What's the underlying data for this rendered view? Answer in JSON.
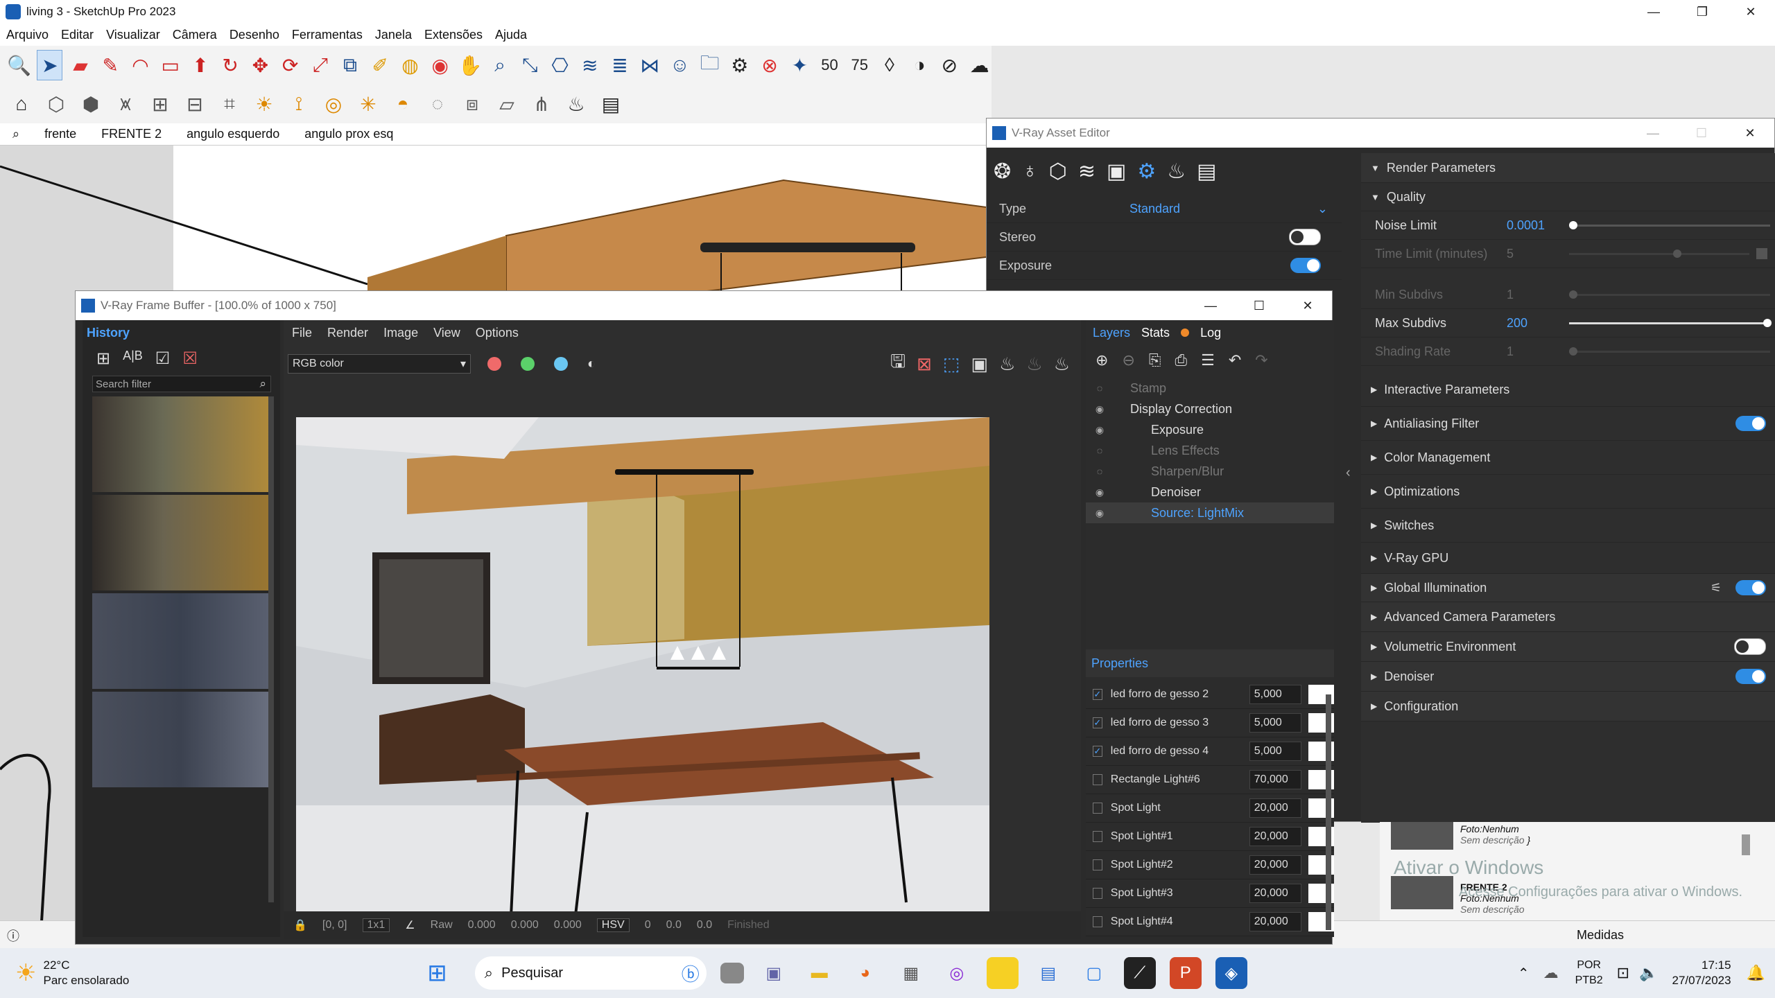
{
  "window": {
    "title": "living 3 - SketchUp Pro 2023"
  },
  "menu": [
    "Arquivo",
    "Editar",
    "Visualizar",
    "Câmera",
    "Desenho",
    "Ferramentas",
    "Janela",
    "Extensões",
    "Ajuda"
  ],
  "scene_tabs": [
    "frente",
    "FRENTE 2",
    "angulo esquerdo",
    "angulo prox esq"
  ],
  "frame_buffer": {
    "title": "V-Ray Frame Buffer - [100.0% of 1000 x 750]",
    "history_label": "History",
    "search_placeholder": "Search filter",
    "menu": [
      "File",
      "Render",
      "Image",
      "View",
      "Options"
    ],
    "channel": "RGB color",
    "bottom": {
      "coords": "[0, 0]",
      "zoom": "1x1",
      "raw": "Raw",
      "r": "0.000",
      "g": "0.000",
      "b": "0.000",
      "mode": "HSV",
      "h": "0",
      "s": "0.0",
      "v": "0.0",
      "status": "Finished"
    },
    "tabs": [
      "Layers",
      "Stats",
      "Log"
    ],
    "layers": [
      {
        "name": "Stamp",
        "state": "dim"
      },
      {
        "name": "Display Correction",
        "state": "on"
      },
      {
        "name": "Exposure",
        "state": "on"
      },
      {
        "name": "Lens Effects",
        "state": "dim"
      },
      {
        "name": "Sharpen/Blur",
        "state": "dim"
      },
      {
        "name": "Denoiser",
        "state": "on"
      },
      {
        "name": "Source: LightMix",
        "state": "selected"
      }
    ],
    "properties_label": "Properties",
    "lightmix": [
      {
        "name": "led forro de gesso 2",
        "value": "5,000",
        "checked": true
      },
      {
        "name": "led forro de gesso 3",
        "value": "5,000",
        "checked": true
      },
      {
        "name": "led forro de gesso 4",
        "value": "5,000",
        "checked": true
      },
      {
        "name": "Rectangle Light#6",
        "value": "70,000",
        "checked": false
      },
      {
        "name": "Spot Light",
        "value": "20,000",
        "checked": false
      },
      {
        "name": "Spot Light#1",
        "value": "20,000",
        "checked": false
      },
      {
        "name": "Spot Light#2",
        "value": "20,000",
        "checked": false
      },
      {
        "name": "Spot Light#3",
        "value": "20,000",
        "checked": false
      },
      {
        "name": "Spot Light#4",
        "value": "20,000",
        "checked": false
      }
    ]
  },
  "asset_editor": {
    "title": "V-Ray Asset Editor",
    "camera": {
      "type_label": "Type",
      "type_value": "Standard",
      "stereo_label": "Stereo",
      "exposure_label": "Exposure"
    },
    "render_params": "Render Parameters",
    "quality": "Quality",
    "quality_rows": [
      {
        "label": "Noise Limit",
        "value": "0.0001",
        "active": true
      },
      {
        "label": "Time Limit (minutes)",
        "value": "5",
        "active": false
      },
      {
        "label": "Min Subdivs",
        "value": "1",
        "active": false
      },
      {
        "label": "Max Subdivs",
        "value": "200",
        "active": true
      },
      {
        "label": "Shading Rate",
        "value": "1",
        "active": false
      }
    ],
    "sections": [
      {
        "label": "Interactive Parameters",
        "toggle": "none"
      },
      {
        "label": "Antialiasing Filter",
        "toggle": "on"
      },
      {
        "label": "Color Management",
        "toggle": "none"
      },
      {
        "label": "Optimizations",
        "toggle": "none"
      },
      {
        "label": "Switches",
        "toggle": "none"
      },
      {
        "label": "V-Ray GPU",
        "toggle": "none"
      },
      {
        "label": "Global Illumination",
        "toggle": "on"
      },
      {
        "label": "Advanced Camera Parameters",
        "toggle": "none"
      },
      {
        "label": "Volumetric Environment",
        "toggle": "off"
      },
      {
        "label": "Denoiser",
        "toggle": "on"
      },
      {
        "label": "Configuration",
        "toggle": "none"
      }
    ]
  },
  "scenes_panel": {
    "items": [
      {
        "name": "",
        "foto": "Foto:",
        "foto_val": "Nenhum",
        "desc": "Sem descrição"
      },
      {
        "name": "FRENTE 2",
        "foto": "Foto:",
        "foto_val": "Nenhum",
        "desc": "Sem descrição"
      }
    ],
    "activate_title": "Ativar o Windows",
    "activate_sub": "Acesse Configurações para ativar o Windows.",
    "medidas": "Medidas"
  },
  "taskbar": {
    "weather_temp": "22°C",
    "weather_desc": "Parc ensolarado",
    "search": "Pesquisar",
    "lang": "POR",
    "layout": "PTB2",
    "time": "17:15",
    "date": "27/07/2023"
  }
}
